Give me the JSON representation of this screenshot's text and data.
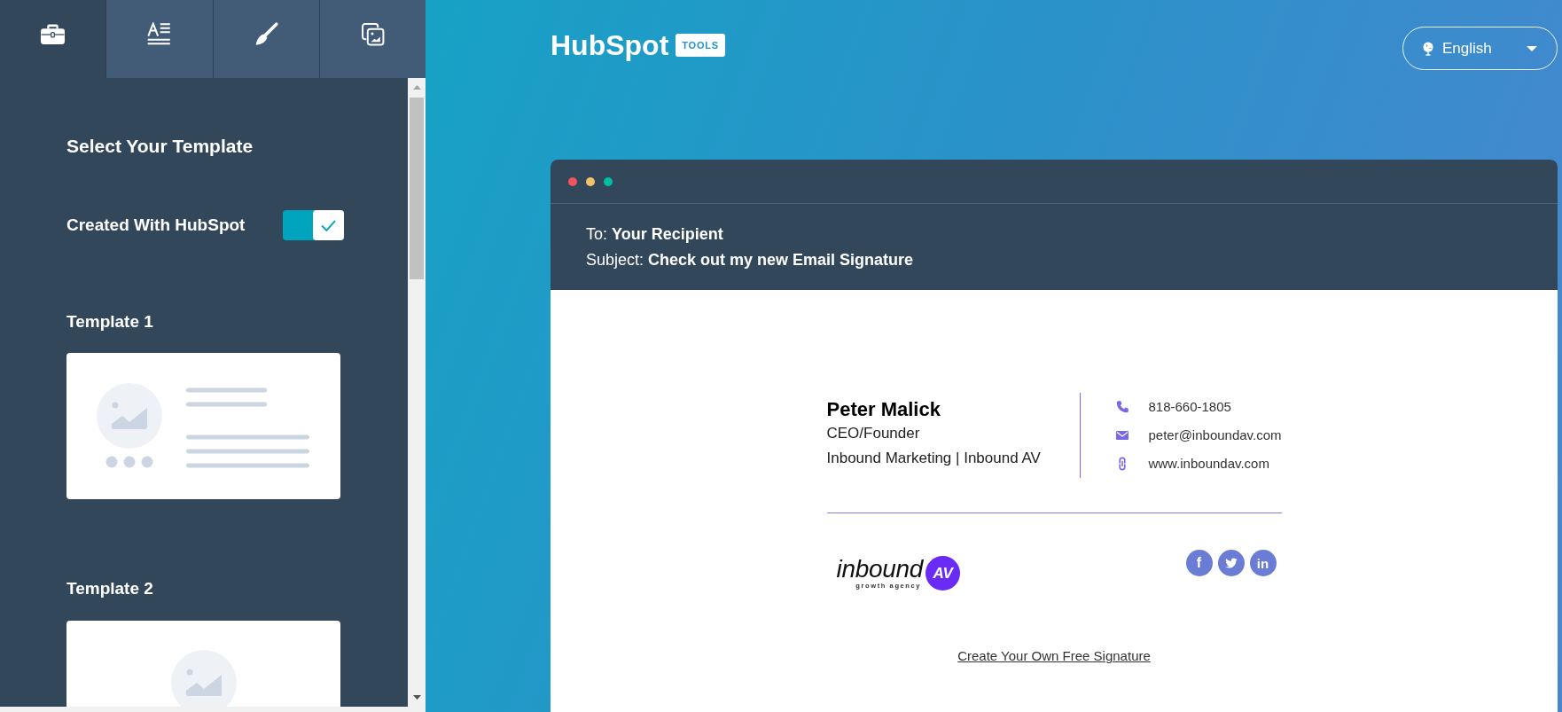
{
  "sidebar": {
    "tabs": [
      {
        "kind": "briefcase",
        "selected": true
      },
      {
        "kind": "text-format",
        "selected": false
      },
      {
        "kind": "brush",
        "selected": false
      },
      {
        "kind": "images",
        "selected": false
      }
    ],
    "heading": "Select Your Template",
    "toggle": {
      "label": "Created With HubSpot",
      "on": true
    },
    "templates": [
      {
        "title": "Template 1",
        "kind": "side"
      },
      {
        "title": "Template 2",
        "kind": "stacked"
      }
    ]
  },
  "header": {
    "logo": {
      "wordmark": "HubSpot",
      "badge": "TOOLS"
    },
    "language": {
      "label": "English"
    }
  },
  "email": {
    "window_dots": [
      {
        "color": "#f2545b"
      },
      {
        "color": "#f5c26b"
      },
      {
        "color": "#00bda5"
      }
    ],
    "to": "To: **Your Recipient**",
    "subject": "Subject: **Check out my new Email Signature**",
    "signature": {
      "name": "Peter Malick",
      "title": "CEO/Founder",
      "company": "Inbound Marketing | Inbound AV",
      "contacts": [
        {
          "kind": "phone",
          "text": "818-660-1805"
        },
        {
          "kind": "email",
          "text": "peter@inboundav.com"
        },
        {
          "kind": "website",
          "text": "www.inboundav.com"
        }
      ],
      "logo": {
        "wordmark": "inbound",
        "badge": "AV",
        "tagline": "growth agency"
      },
      "social": [
        {
          "kind": "facebook",
          "glyph": "f"
        },
        {
          "kind": "twitter"
        },
        {
          "kind": "linkedin",
          "glyph": "in"
        }
      ]
    },
    "footer_link": "Create Your Own Free Signature"
  }
}
